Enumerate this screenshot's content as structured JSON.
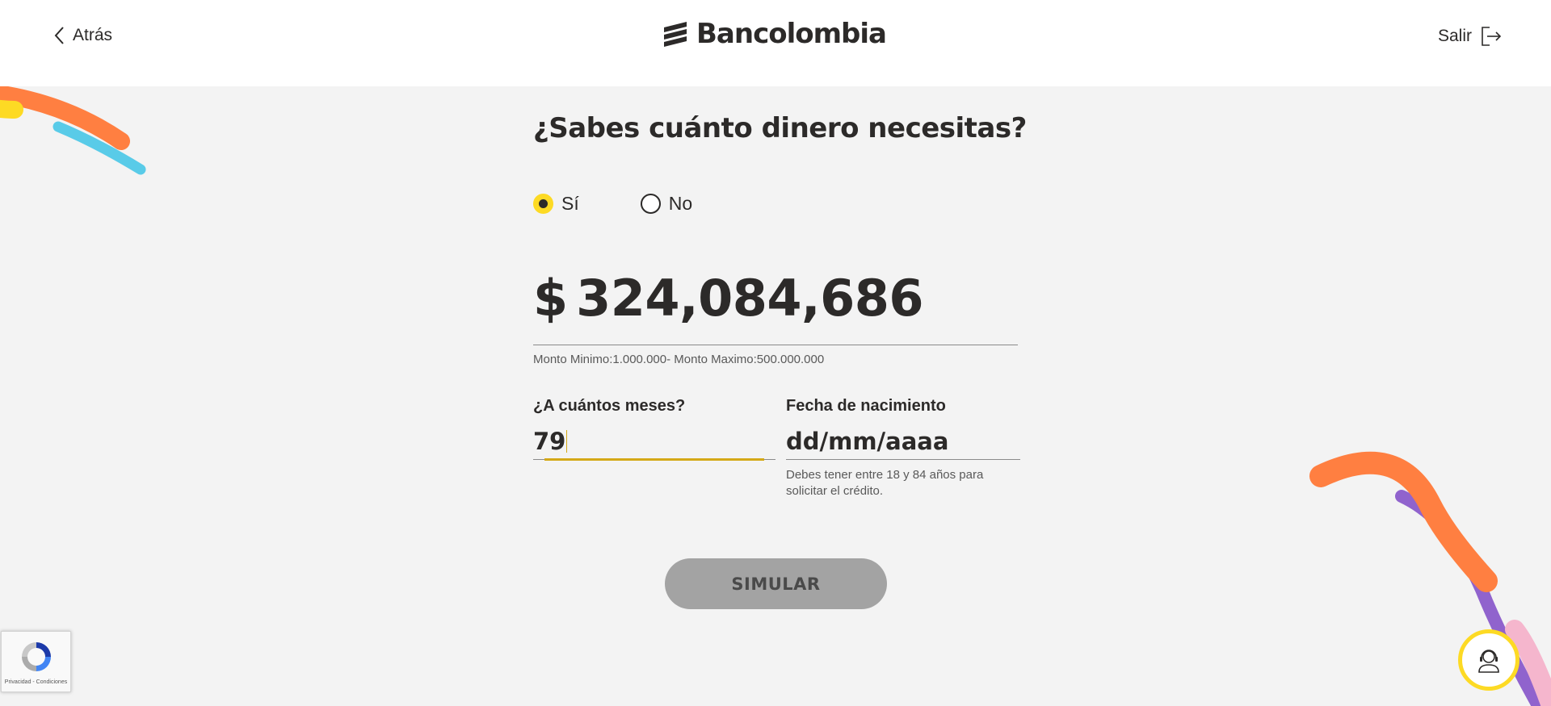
{
  "header": {
    "back_label": "Atrás",
    "brand_name": "Bancolombia",
    "exit_label": "Salir"
  },
  "form": {
    "question": "¿Sabes cuánto dinero necesitas?",
    "options": [
      {
        "label": "Sí",
        "selected": true
      },
      {
        "label": "No",
        "selected": false
      }
    ],
    "amount": {
      "currency_symbol": "$",
      "value": "324,084,686",
      "hint": "Monto Minimo:1.000.000- Monto Maximo:500.000.000"
    },
    "months": {
      "label": "¿A cuántos meses?",
      "value": "79"
    },
    "birthdate": {
      "label": "Fecha de nacimiento",
      "placeholder": "dd/mm/aaaa",
      "help": "Debes tener entre 18 y 84 años para solicitar el crédito."
    },
    "submit_label": "SIMULAR"
  },
  "recaptcha": {
    "footer_text": "Privacidad - Condiciones"
  },
  "colors": {
    "brand_yellow": "#fdda24",
    "deco_orange": "#ff7f41",
    "deco_blue": "#59cbe8",
    "deco_purple": "#9063cd",
    "deco_pink": "#f5b6cd",
    "button_disabled": "#a3a3a3"
  },
  "icons": {
    "back": "chevron-left-icon",
    "logo": "bancolombia-logo-icon",
    "exit": "exit-icon",
    "recaptcha": "recaptcha-icon",
    "help": "support-agent-icon"
  }
}
